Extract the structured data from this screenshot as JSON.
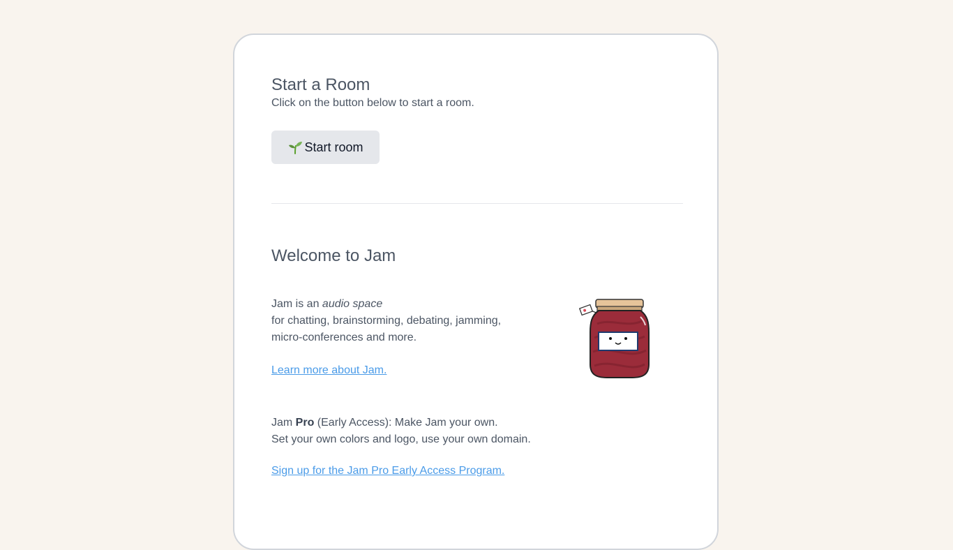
{
  "start_section": {
    "title": "Start a Room",
    "subtitle": "Click on the button below to start a room.",
    "button_label": "Start room",
    "button_icon": "seedling-icon"
  },
  "welcome_section": {
    "title": "Welcome to Jam",
    "intro_prefix": "Jam is an ",
    "intro_emphasis": "audio space",
    "intro_line2": "for chatting, brainstorming, debating, jamming,",
    "intro_line3": "micro-conferences and more.",
    "learn_more_link": "Learn more about Jam.",
    "pro_prefix": "Jam ",
    "pro_bold": "Pro",
    "pro_suffix": " (Early Access): Make Jam your own.",
    "pro_line2": "Set your own colors and logo, use your own domain.",
    "signup_link": "Sign up for the Jam Pro Early Access Program.",
    "illustration": "jam-jar-illustration"
  },
  "colors": {
    "background": "#f9f4ee",
    "card": "#ffffff",
    "button": "#e5e7eb",
    "link": "#4a9be8",
    "jam": "#9b2c3a"
  }
}
